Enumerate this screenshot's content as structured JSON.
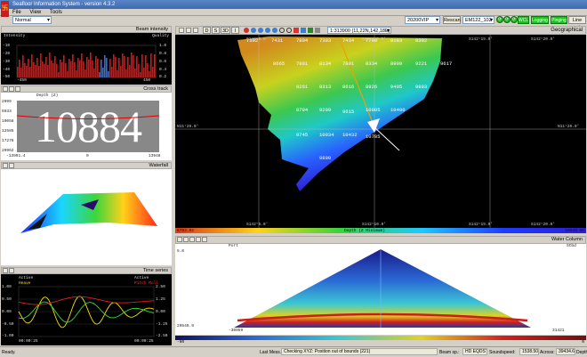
{
  "app": {
    "title": "Seafloor Information System - version 4.3.2",
    "logo_glyph": "卐"
  },
  "menu": {
    "items": [
      "File",
      "View",
      "Tools"
    ]
  },
  "top_toolbar": {
    "mode_select": "Normal",
    "vessel_select": "20200VIP",
    "rescan_label": "Rescan",
    "sonar_select": "EM122_102",
    "wcl_label": "WCL",
    "logging_label": "Logging",
    "pinging_label": "Pinging",
    "linecnt_label": "Line cnt."
  },
  "geo_toolbar": {
    "view_buttons": [
      "D",
      "S",
      "3D",
      "I"
    ],
    "scale_text": "1:313900 (11,22N,142,18E)"
  },
  "beam_intensity": {
    "title": "Beam intensity",
    "left_label": "Intensity",
    "right_label": "Quality",
    "y_left": [
      "-10",
      "-20",
      "-30",
      "-40",
      "-50"
    ],
    "y_right": [
      "1.0",
      "0.8",
      "0.6",
      "0.4",
      "0.2"
    ],
    "x_left": "-450",
    "x_right": "450"
  },
  "cross_track": {
    "title": "Cross track",
    "axis_label": "Depth (Z)",
    "big_depth": "10884",
    "y_ticks": [
      "2099",
      "6033",
      "10058",
      "12585",
      "17276",
      "20962"
    ],
    "x_ticks": [
      "-13991.4",
      "0",
      "13948"
    ]
  },
  "waterfall": {
    "title": "Waterfall"
  },
  "time_series": {
    "title": "Time series",
    "legend_left_1": "Active",
    "legend_left_2": "Heave",
    "legend_right_1": "Active",
    "legend_right_2": "Pitch Roll",
    "y_left": [
      "1.00",
      "0.50",
      "0.00",
      "-0.50",
      "-1.00"
    ],
    "y_right": [
      "2.50",
      "1.25",
      "0.00",
      "-1.25",
      "-2.50"
    ],
    "x_left": "00:00:25",
    "x_right": "00:00:25"
  },
  "geographical": {
    "title": "Geographical",
    "top_lon": [
      "S142°5.0'",
      "S142°10.0'",
      "S142°15.0'",
      "S142°20.0'"
    ],
    "bottom_lon": [
      "S142°5.0'",
      "S142°10.0'",
      "S142°15.0'",
      "S142°20.0'"
    ],
    "lat_left": "N11°20.0'",
    "lat_right": "N11°20.0'",
    "depth_labels": [
      "7392",
      "7431",
      "7894",
      "7303",
      "7434",
      "7700",
      "8183",
      "8392",
      "8665",
      "7881",
      "8134",
      "7891",
      "8334",
      "8909",
      "9221",
      "9617",
      "8261",
      "8313",
      "8616",
      "8926",
      "9495",
      "9893",
      "8794",
      "9209",
      "9615",
      "10085",
      "10490",
      "9745",
      "10034",
      "10432",
      "10785",
      "9890"
    ],
    "legend_min": "6793.02",
    "legend_label": "Depth (Z Minimum)",
    "legend_max": "10949.66"
  },
  "water_column": {
    "title": "Water Column",
    "top_left": "Port",
    "top_right": "Stbd",
    "y_top": "5.0",
    "y_bottom": "20549.9",
    "x_left": "-30059",
    "x_right": "31421",
    "colorbar_min": "-60",
    "colorbar_max": "0"
  },
  "status": {
    "ready": "Ready.",
    "last_msg_label": "Last Mess.:",
    "last_msg": "Checking XYZ: Position out of bounds (221)",
    "beam_sp_label": "Beam sp.:",
    "beam_sp": "HD EQDST",
    "soundspeed_label": "Soundspeed:",
    "soundspeed": "1538.50",
    "across_label": "Across:",
    "across": "39434.66",
    "depth_label": "Depth"
  },
  "colors": {
    "accent_green": "#19c21e",
    "title_blue": "#3c6ab2"
  }
}
